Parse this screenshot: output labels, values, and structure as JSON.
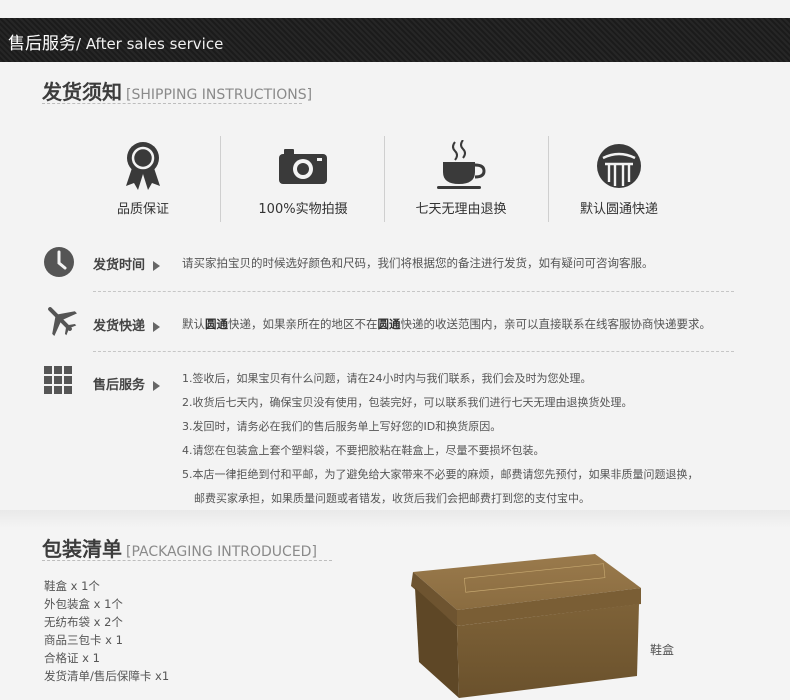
{
  "header": {
    "title_cn": "售后服务",
    "title_en": "/ After sales service"
  },
  "shipping": {
    "title_cn": "发货须知",
    "title_en": "[SHIPPING INSTRUCTIONS]",
    "features": [
      {
        "icon": "ribbon-badge-icon",
        "label": "品质保证"
      },
      {
        "icon": "camera-icon",
        "label": "100%实物拍摄"
      },
      {
        "icon": "coffee-cup-icon",
        "label": "七天无理由退换"
      },
      {
        "icon": "courier-logo-icon",
        "label": "默认圆通快递"
      }
    ],
    "time": {
      "icon": "clock-icon",
      "label": "发货时间",
      "text": "请买家拍宝贝的时候选好颜色和尺码，我们将根据您的备注进行发货，如有疑问可咨询客服。"
    },
    "express": {
      "icon": "airplane-icon",
      "label": "发货快递",
      "text_parts": [
        "默认",
        "圆通",
        "快递，如果亲所在的地区不在",
        "圆通",
        "快递的收送范围内，亲可以直接联系在线客服协商快递要求。"
      ]
    },
    "service": {
      "icon": "grid-icon",
      "label": "售后服务",
      "lines": [
        "1.签收后，如果宝贝有什么问题，请在24小时内与我们联系，我们会及时为您处理。",
        "2.收货后七天内，确保宝贝没有使用，包装完好，可以联系我们进行七天无理由退换货处理。",
        "3.发回时，请务必在我们的售后服务单上写好您的ID和换货原因。",
        "4.请您在包装盒上套个塑料袋，不要把胶粘在鞋盒上，尽量不要损坏包装。",
        "5.本店一律拒绝到付和平邮，为了避免给大家带来不必要的麻烦，邮费请您先预付，如果非质量问题退换，",
        "邮费买家承担，如果质量问题或者错发，收货后我们会把邮费打到您的支付宝中。"
      ]
    }
  },
  "packaging": {
    "title_cn": "包装清单",
    "title_en": "[PACKAGING INTRODUCED]",
    "items": [
      "鞋盒 x 1个",
      "外包装盒 x 1个",
      "无纺布袋 x 2个",
      "商品三包卡 x 1",
      "合格证 x 1",
      "发货清单/售后保障卡 x1"
    ],
    "box_label": "鞋盒"
  }
}
